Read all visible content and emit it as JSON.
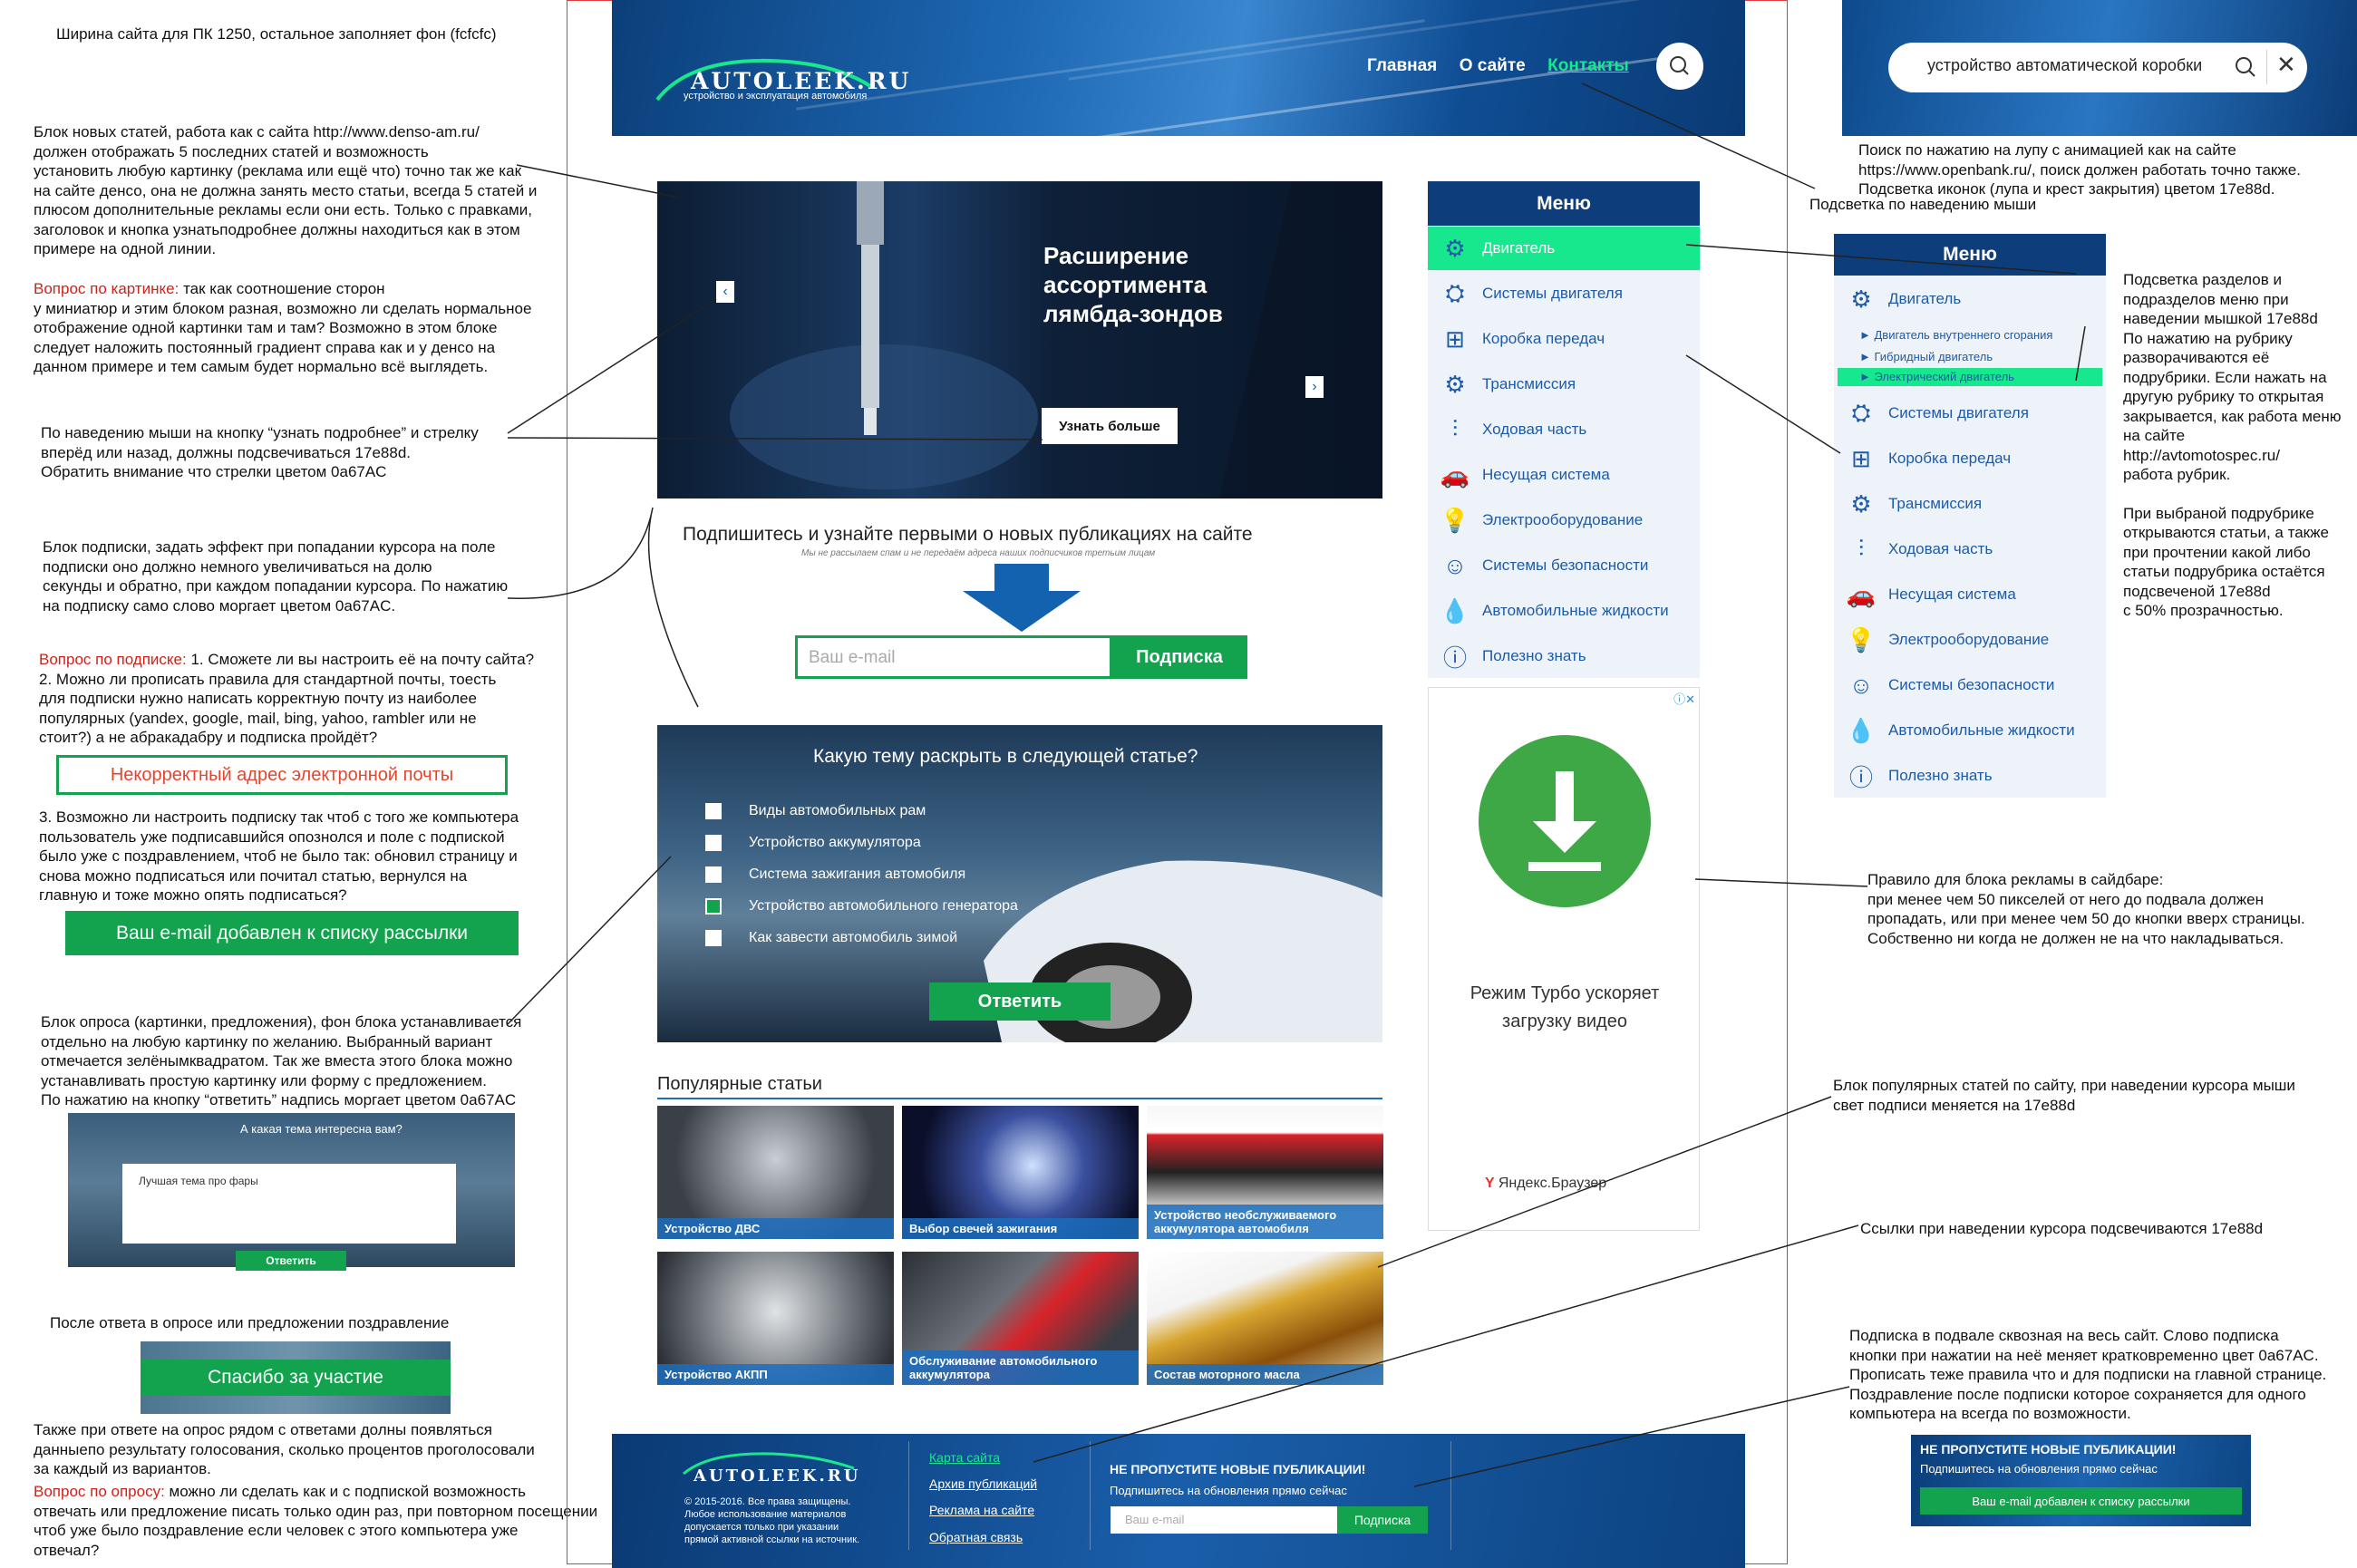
{
  "notes": {
    "width_note": "Ширина сайта для ПК 1250, остальное заполняет фон (fcfcfc)",
    "slider_note": [
      "Блок новых статей, работа как с сайта http://www.denso-am.ru/",
      "должен отображать 5 последних статей и возможность",
      "установить любую картинку (реклама или ещё что) точно так же как",
      "на сайте денсо, она не должна занять место статьи, всегда 5 статей и",
      "плюсом дополнительные рекламы если они есть.  Только с правками,",
      "заголовок и кнопка узнатьподробнее должны находиться как в этом",
      "примере на одной линии."
    ],
    "image_q_label": "Вопрос по картинке:",
    "image_q": [
      " так как соотношение сторон",
      "у миниатюр и этим блоком разная, возможно ли сделать нормальное",
      "отображение одной картинки там и там? Возможно в этом блоке",
      "следует наложить постоянный градиент справа как и у денсо на",
      "данном примере и тем самым будет нормально всё выглядеть."
    ],
    "hover_note": [
      "По наведению мыши на кнопку “узнать подробнее” и стрелку",
      "вперёд или назад, должны подсвечиваться 17e88d.",
      "Обратить внимание что стрелки цветом 0a67AC"
    ],
    "subscribe_note": [
      "Блок подписки, задать эффект при попадании курсора на поле",
      "подписки оно должно немного увеличиваться на долю",
      "секунды и обратно, при каждом попадании курсора. По нажатию",
      "на подписку само слово моргает цветом 0a67AC."
    ],
    "sub_q_label": "Вопрос по подписке:",
    "sub_q": [
      " 1. Сможете ли вы настроить её на почту сайта?",
      "2. Можно ли прописать правила для стандартной почты, тоесть",
      "для подписки нужно написать корректную почту из наиболее",
      "популярных (yandex, google, mail, bing, yahoo, rambler или не",
      "стоит?) а не абракадабру и подписка пройдёт?"
    ],
    "invalid_email": "Некорректный адрес электронной почты",
    "sub_q3": [
      "3. Возможно ли настроить подписку так чтоб с того же компьютера",
      "пользователь уже подписавшийся опознолся и поле с подпиской",
      "было уже с поздравлением, чтоб не было так: обновил страницу и",
      "снова можно подписаться или почитал статью, вернулся на",
      "главную и тоже можно опять подписаться?"
    ],
    "email_added": "Ваш e-mail добавлен к списку рассылки",
    "poll_note": [
      "Блок опроса (картинки, предложения), фон блока устанавливается",
      "отдельно на любую картинку по желанию. Выбранный вариант",
      "отмечается зелёнымквадратом. Так же вместа этого блока можно",
      "устанавливать простую картинку или форму с предложением.",
      "По нажатию на кнопку “ответить” надпись моргает цветом 0a67AC"
    ],
    "mini_poll_q": "А какая тема интересна вам?",
    "mini_poll_text": "Лучшая тема про фары",
    "mini_poll_btn": "Ответить",
    "after_poll": "После ответа в опросе или предложении поздравление",
    "thanks": "Спасибо за участие",
    "vote_note": [
      "Также при ответе на опрос рядом с ответами долны появляться",
      "данныепо результату голосования, сколько процентов проголосовали",
      "за каждый из вариантов."
    ],
    "poll_q_label": "Вопрос по опросу:",
    "poll_q": [
      " можно ли сделать как и с подпиской возможность",
      "отвечать или предложение писать только один раз, при повторном посещении",
      "чтоб уже было поздравление если человек с этого компьютера уже",
      "отвечал?"
    ],
    "search_note": [
      "Поиск по нажатию на лупу с анимацией как на сайте",
      "https://www.openbank.ru/, поиск должен работать точно также.",
      "Подсветка иконок (лупа и крест закрытия) цветом 17e88d."
    ],
    "hover_nav": "Подсветка по наведению мыши",
    "menu_note": [
      "Подсветка разделов и",
      "подразделов меню при",
      "наведении мышкой 17e88d",
      "По нажатию на рубрику",
      "разворачиваются её",
      "подрубрики. Если нажать на",
      "другую рубрику то открытая",
      "закрывается, как работа меню",
      "на сайте",
      "http://avtomotospec.ru/",
      "работа рубрик.",
      "",
      "При выбраной подрубрике",
      "открываются статьи, а также",
      "при прочтении какой либо",
      "статьи подрубрика остаётся",
      "подсвеченой 17e88d",
      "с 50% прозрачностью."
    ],
    "ad_note": [
      "Правило для блока рекламы в сайдбаре:",
      "при менее чем 50 пикселей от него до подвала должен",
      "пропадать, или при менее чем 50 до кнопки вверх страницы.",
      "Собственно ни когда не должен не на что накладываться."
    ],
    "popular_note": [
      "Блок популярных статей по сайту, при наведении курсора мыши",
      "свет подписи меняется на 17e88d"
    ],
    "links_note": "Ссылки при наведении курсора подсвечиваются 17e88d",
    "footer_note": [
      "Подписка в подвале сквозная на весь сайт. Слово подписка",
      "кнопки при нажатии на неё меняет кратковременно цвет 0a67AC.",
      "Прописать теже правила что и для подписки на главной странице.",
      "Поздравление после подписки которое сохраняется для одного",
      "компьютера на всегда по возможности."
    ]
  },
  "header": {
    "logo": "AUTOLEEK.RU",
    "tagline": "устройство и эксплуатация автомобиля",
    "nav": [
      "Главная",
      "О сайте",
      "Контакты"
    ],
    "search_value": "устройство автоматической коробки"
  },
  "slider": {
    "title": [
      "Расширение",
      "ассортимента",
      "лямбда-зондов"
    ],
    "button": "Узнать больше"
  },
  "subscribe": {
    "heading": "Подпишитесь и узнайте первыми о новых публикациях на сайте",
    "subtext": "Мы не рассылаем спам и не передаём адреса наших подписчиков третьим лицам",
    "placeholder": "Ваш e-mail",
    "button": "Подписка"
  },
  "poll": {
    "question": "Какую тему раскрыть в следующей статье?",
    "options": [
      "Виды автомобильных рам",
      "Устройство аккумулятора",
      "Система зажигания автомобиля",
      "Устройство автомобильного генератора",
      "Как завести автомобиль зимой"
    ],
    "selected_index": 3,
    "button": "Ответить"
  },
  "popular": {
    "title": "Популярные статьи",
    "items": [
      "Устройство ДВС",
      "Выбор свечей зажигания",
      "Устройство необслуживаемого аккумулятора автомобиля",
      "Устройство АКПП",
      "Обслуживание автомобильного аккумулятора",
      "Состав моторного масла"
    ]
  },
  "menu": {
    "title": "Меню",
    "items": [
      "Двигатель",
      "Системы двигателя",
      "Коробка передач",
      "Трансмиссия",
      "Ходовая часть",
      "Несущая система",
      "Электрооборудование",
      "Системы безопасности",
      "Автомобильные жидкости",
      "Полезно знать"
    ],
    "sub_items": [
      "Двигатель внутреннего сгорания",
      "Гибридный двигатель",
      "Электрический двигатель"
    ]
  },
  "ad": {
    "text": [
      "Режим Турбо ускоряет",
      "загрузку видео"
    ],
    "brand": "Яндекс.Браузер"
  },
  "footer": {
    "logo": "AUTOLEEK.RU",
    "copyright": [
      "© 2015-2016. Все права защищены.",
      "Любое использование материалов",
      "допускается только при указании",
      "прямой активной ссылки на источник."
    ],
    "links": [
      "Карта сайта",
      "Архив публикаций",
      "Реклама на сайте",
      "Обратная связь"
    ],
    "sub_title": "НЕ ПРОПУСТИТЕ НОВЫЕ ПУБЛИКАЦИИ!",
    "sub_text": "Подпишитесь на обновления прямо сейчас",
    "placeholder": "Ваш e-mail",
    "button": "Подписка",
    "added": "Ваш e-mail добавлен к списку рассылки"
  },
  "colors": {
    "highlight": "#17e88d",
    "arrows": "#0a67AC",
    "green_button": "#13a34f",
    "menu_header": "#0d3d7a"
  }
}
